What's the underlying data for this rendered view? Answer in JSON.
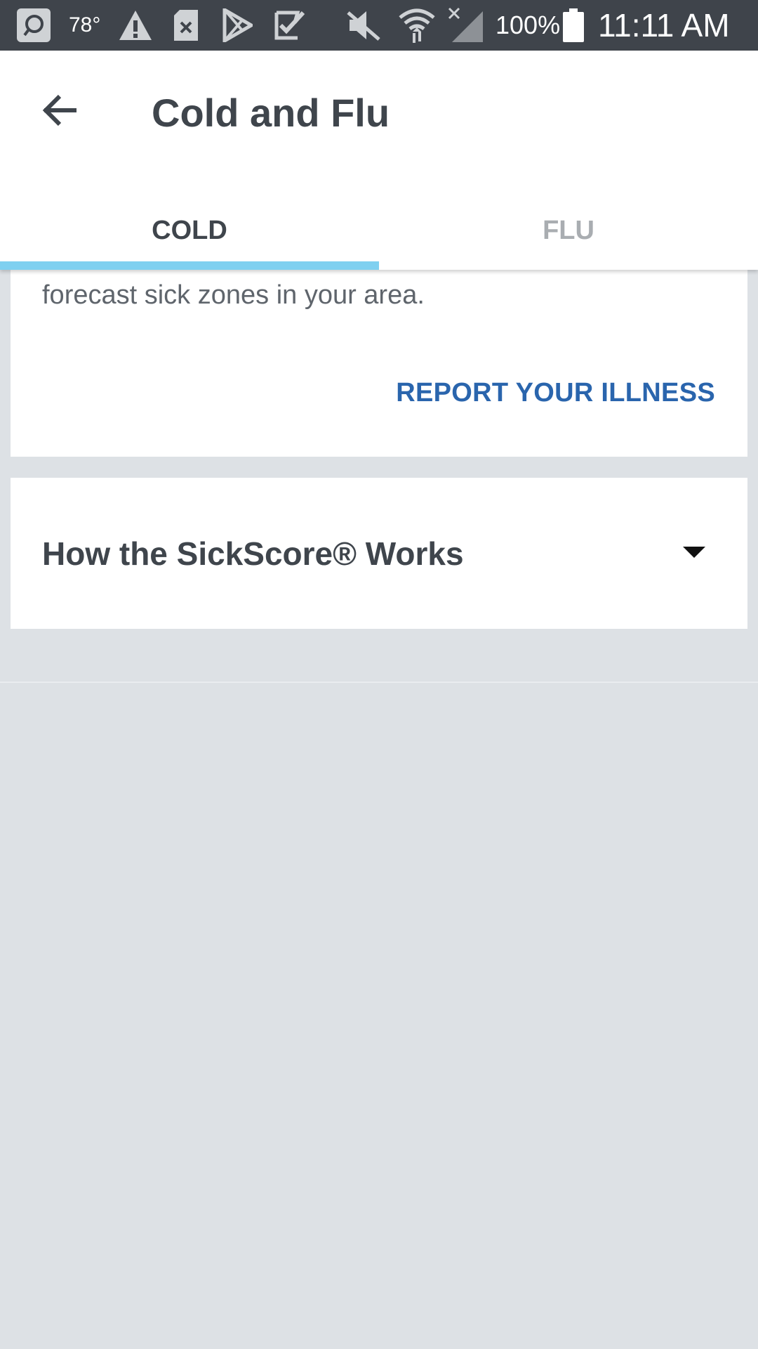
{
  "statusbar": {
    "temperature": "78°",
    "battery_percent": "100%",
    "time": "11:11 AM",
    "icons": [
      "chat-icon",
      "warning-icon",
      "sd-card-error-icon",
      "play-store-icon",
      "task-check-icon",
      "mute-icon",
      "wifi-icon",
      "no-signal-icon",
      "battery-icon"
    ]
  },
  "appbar": {
    "title": "Cold and Flu",
    "tabs": [
      {
        "label": "COLD",
        "selected": true
      },
      {
        "label": "FLU",
        "selected": false
      }
    ]
  },
  "report_card": {
    "description": "forecast sick zones in your area.",
    "action_label": "REPORT YOUR ILLNESS"
  },
  "sickscore_card": {
    "heading": "How the SickScore® Works"
  },
  "colors": {
    "accent": "#7fd0f0",
    "link": "#2a65ad",
    "background": "#dde1e5",
    "status_bar": "#3f444b"
  }
}
